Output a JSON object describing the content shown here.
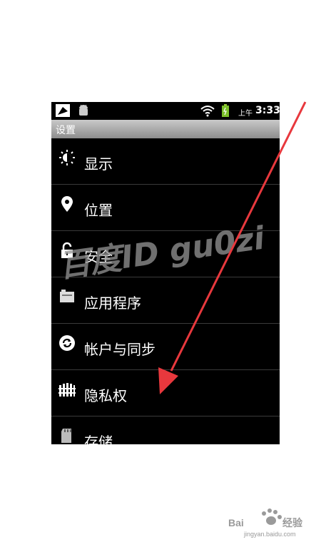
{
  "status_bar": {
    "ampm": "上午",
    "time": "3:33"
  },
  "title": "设置",
  "items": [
    {
      "label": "显示",
      "icon": "brightness-icon"
    },
    {
      "label": "位置",
      "icon": "location-pin-icon"
    },
    {
      "label": "安全",
      "icon": "lock-icon"
    },
    {
      "label": "应用程序",
      "icon": "apps-icon"
    },
    {
      "label": "帐户与同步",
      "icon": "sync-icon"
    },
    {
      "label": "隐私权",
      "icon": "privacy-icon"
    },
    {
      "label": "存储",
      "icon": "sd-card-icon"
    }
  ],
  "watermark": "百度ID  gu0zi",
  "colors": {
    "arrow": "#e8383d",
    "title_bar": "#a8a8a8"
  }
}
